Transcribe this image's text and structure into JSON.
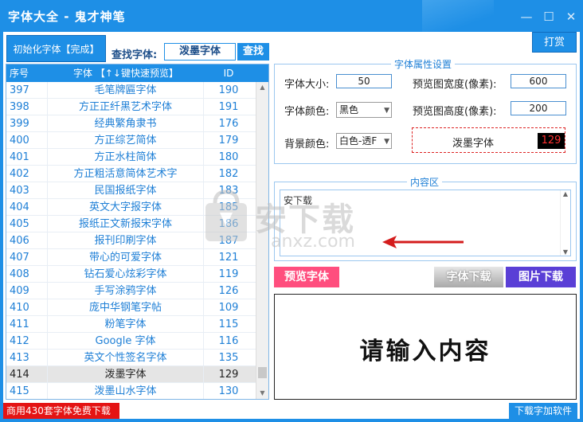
{
  "app": {
    "title": "字体大全 - 鬼才神笔"
  },
  "window_controls": {
    "minimize": "—",
    "maximize": "☐",
    "close": "✕"
  },
  "toolbar": {
    "init_button": "初始化字体【完成】",
    "search_label": "查找字体:",
    "search_value": "泼墨字体",
    "search_button": "查找",
    "tip_button": "打赏"
  },
  "table": {
    "headers": [
      "序号",
      "字体 【↑↓键快速预览】",
      "ID"
    ],
    "selected_index": 17,
    "rows": [
      {
        "no": "397",
        "name": "毛笔牌匾字体",
        "id": "190"
      },
      {
        "no": "398",
        "name": "方正正纤黑艺术字体",
        "id": "191"
      },
      {
        "no": "399",
        "name": "经典繁角隶书",
        "id": "176"
      },
      {
        "no": "400",
        "name": "方正综艺简体",
        "id": "179"
      },
      {
        "no": "401",
        "name": "方正水柱简体",
        "id": "180"
      },
      {
        "no": "402",
        "name": "方正粗活意简体艺术字",
        "id": "182"
      },
      {
        "no": "403",
        "name": "民国报纸字体",
        "id": "183"
      },
      {
        "no": "404",
        "name": "英文大字报字体",
        "id": "185"
      },
      {
        "no": "405",
        "name": "报纸正文新报宋字体",
        "id": "186"
      },
      {
        "no": "406",
        "name": "报刊印刷字体",
        "id": "187"
      },
      {
        "no": "407",
        "name": "带心的可爱字体",
        "id": "121"
      },
      {
        "no": "408",
        "name": "钻石爱心炫彩字体",
        "id": "119"
      },
      {
        "no": "409",
        "name": "手写涂鸦字体",
        "id": "126"
      },
      {
        "no": "410",
        "name": "庞中华钢笔字帖",
        "id": "109"
      },
      {
        "no": "411",
        "name": "粉笔字体",
        "id": "115"
      },
      {
        "no": "412",
        "name": "Google 字体",
        "id": "116"
      },
      {
        "no": "413",
        "name": "英文个性签名字体",
        "id": "135"
      },
      {
        "no": "414",
        "name": "泼墨字体",
        "id": "129"
      },
      {
        "no": "415",
        "name": "泼墨山水字体",
        "id": "130"
      }
    ]
  },
  "props": {
    "group_title": "字体属性设置",
    "font_size_label": "字体大小:",
    "font_size": "50",
    "font_color_label": "字体颜色:",
    "font_color": "黑色",
    "bg_color_label": "背景颜色:",
    "bg_color": "白色-透F",
    "width_label": "预览图宽度(像素):",
    "width": "600",
    "height_label": "预览图高度(像素):",
    "height": "200",
    "preview_name": "泼墨字体",
    "preview_id": "129"
  },
  "content": {
    "group_title": "内容区",
    "text": "安下载"
  },
  "actions": {
    "preview": "预览字体",
    "download_font": "字体下载",
    "download_image": "图片下载"
  },
  "canvas": {
    "text": "请输入内容"
  },
  "footer": {
    "left": "商用430套字体免费下载",
    "right": "下载字加软件"
  },
  "watermark": {
    "cn": "安下载",
    "en": "anxz.com"
  },
  "colors": {
    "accent": "#1e8fe6",
    "pink": "#ff4e7e",
    "purple": "#5a3fd6",
    "red": "#e41414"
  }
}
